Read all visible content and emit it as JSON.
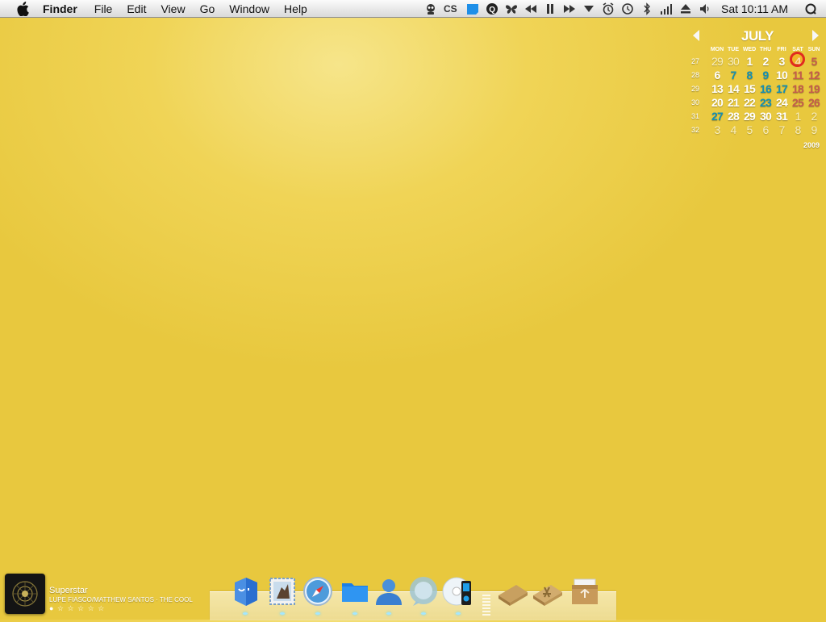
{
  "menubar": {
    "app_name": "Finder",
    "menus": [
      "File",
      "Edit",
      "View",
      "Go",
      "Window",
      "Help"
    ],
    "clock": "Sat 10:11 AM"
  },
  "calendar": {
    "month": "JULY",
    "year": "2009",
    "day_headers": [
      "MON",
      "TUE",
      "WED",
      "THU",
      "FRI",
      "SAT",
      "SUN"
    ],
    "weeks": [
      {
        "num": "27",
        "days": [
          "29",
          "30",
          "1",
          "2",
          "3",
          "4",
          "5"
        ]
      },
      {
        "num": "28",
        "days": [
          "6",
          "7",
          "8",
          "9",
          "10",
          "11",
          "12"
        ]
      },
      {
        "num": "29",
        "days": [
          "13",
          "14",
          "15",
          "16",
          "17",
          "18",
          "19"
        ]
      },
      {
        "num": "30",
        "days": [
          "20",
          "21",
          "22",
          "23",
          "24",
          "25",
          "26"
        ]
      },
      {
        "num": "31",
        "days": [
          "27",
          "28",
          "29",
          "30",
          "31",
          "1",
          "2"
        ]
      },
      {
        "num": "32",
        "days": [
          "3",
          "4",
          "5",
          "6",
          "7",
          "8",
          "9"
        ]
      }
    ],
    "today": "4",
    "colors": {
      "teal": "#138fb3",
      "weekend": "#c45c4c",
      "today_ring": "#e12b1f"
    }
  },
  "now_playing": {
    "title": "Superstar",
    "artist_album": "LUPE FIASCO/MATTHEW SANTOS · THE COOL",
    "rating": "● ☆ ☆ ☆ ☆ ☆"
  },
  "dock": {
    "items": [
      "finder-icon",
      "mail-icon",
      "safari-icon",
      "folder-icon",
      "ichat-icon",
      "speech-bubble-icon",
      "itunes-icon",
      "stack-icon",
      "applications-icon",
      "recycle-trash-icon"
    ]
  },
  "colors": {
    "desktop": "#f0d456",
    "menubar": "#e6e6e6"
  }
}
